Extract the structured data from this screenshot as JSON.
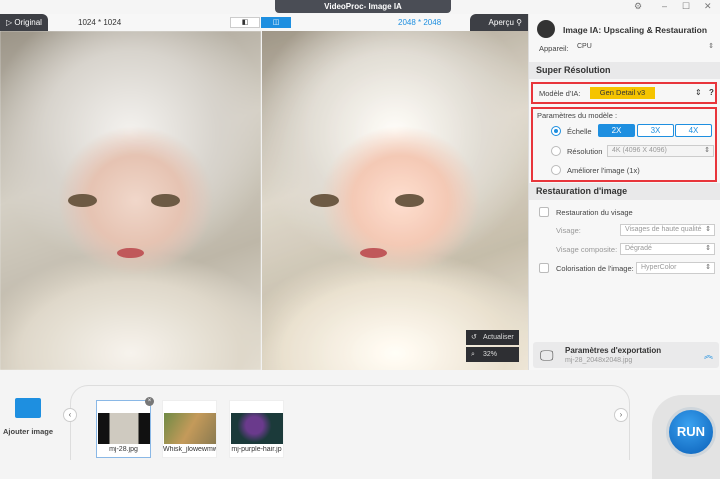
{
  "window": {
    "title": "VideoProc- Image IA"
  },
  "viewer": {
    "original_label": "▷ Original",
    "original_res": "1024 * 1024",
    "output_res": "2048 * 2048",
    "preview_label": "Aperçu",
    "refresh_label": "Actualiser",
    "zoom_label": "32%"
  },
  "panel": {
    "title": "Image IA: Upscaling & Restauration",
    "device_label": "Appareil:",
    "device_value": "CPU",
    "super_res": {
      "heading": "Super Résolution",
      "model_label": "Modèle d'IA:",
      "model_value": "Gen Detail v3",
      "help": "?",
      "params_label": "Paramètres du modèle :",
      "scale_label": "Échelle",
      "scales": [
        "2X",
        "3X",
        "4X"
      ],
      "selected_scale": "2X",
      "resolution_label": "Résolution",
      "resolution_value": "4K (4096 X 4096)",
      "enhance_label": "Améliorer l'image (1x)"
    },
    "restore": {
      "heading": "Restauration d'image",
      "face_label": "Restauration du visage",
      "visage_label": "Visage:",
      "visage_value": "Visages de haute qualité",
      "composite_label": "Visage composite:",
      "composite_value": "Dégradé",
      "color_label": "Colorisation de l'image:",
      "color_value": "HyperColor"
    },
    "export": {
      "title": "Paramètres d'exportation",
      "file": "mj-28_2048x2048.jpg"
    }
  },
  "bottom": {
    "add_label": "Ajouter image",
    "run_label": "RUN",
    "files": [
      {
        "name": "mj-28.jpg"
      },
      {
        "name": "Whisk_jlowewmw"
      },
      {
        "name": "mj-purple-hair.jp"
      }
    ]
  },
  "colors": {
    "accent": "#1e8fe0",
    "model_highlight": "#f5c400",
    "red_box": "#e8353b"
  }
}
